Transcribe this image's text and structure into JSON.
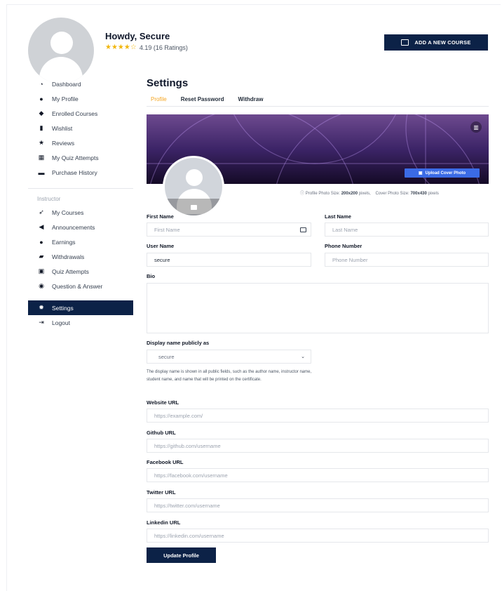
{
  "header": {
    "greeting": "Howdy, Secure",
    "stars": "★★★★☆",
    "rating_text": "4.19 (16 Ratings)",
    "add_course_label": "ADD A NEW COURSE"
  },
  "sidebar": {
    "items": [
      {
        "label": "Dashboard",
        "icon": "dashboard-icon",
        "glyph": "◔"
      },
      {
        "label": "My Profile",
        "icon": "user-icon",
        "glyph": "●"
      },
      {
        "label": "Enrolled Courses",
        "icon": "graduation-cap-icon",
        "glyph": "◆"
      },
      {
        "label": "Wishlist",
        "icon": "bookmark-icon",
        "glyph": "▮"
      },
      {
        "label": "Reviews",
        "icon": "star-icon",
        "glyph": "★"
      },
      {
        "label": "My Quiz Attempts",
        "icon": "quiz-icon",
        "glyph": "▦"
      },
      {
        "label": "Purchase History",
        "icon": "cart-icon",
        "glyph": "▬"
      }
    ],
    "section_label": "Instructor",
    "instructor_items": [
      {
        "label": "My Courses",
        "icon": "rocket-icon",
        "glyph": "➶"
      },
      {
        "label": "Announcements",
        "icon": "megaphone-icon",
        "glyph": "◀"
      },
      {
        "label": "Earnings",
        "icon": "dollar-icon",
        "glyph": "●"
      },
      {
        "label": "Withdrawals",
        "icon": "wallet-icon",
        "glyph": "▰"
      },
      {
        "label": "Quiz Attempts",
        "icon": "question-icon",
        "glyph": "▣"
      },
      {
        "label": "Question & Answer",
        "icon": "chat-icon",
        "glyph": "◉"
      }
    ],
    "settings_label": "Settings",
    "logout_label": "Logout"
  },
  "main": {
    "title": "Settings",
    "tabs": [
      "Profile",
      "Reset Password",
      "Withdraw"
    ],
    "upload_cover_label": "Upload Cover Photo",
    "photo_info": {
      "profile_prefix": "Profile Photo Size: ",
      "profile_size": "200x200",
      "profile_suffix": " pixels,",
      "cover_prefix": "Cover Photo Size: ",
      "cover_size": "700x430",
      "cover_suffix": " pixels"
    },
    "fields": {
      "first_name": {
        "label": "First Name",
        "placeholder": "First Name"
      },
      "last_name": {
        "label": "Last Name",
        "placeholder": "Last Name"
      },
      "user_name": {
        "label": "User Name",
        "value": "secure"
      },
      "phone": {
        "label": "Phone Number",
        "placeholder": "Phone Number"
      },
      "bio": {
        "label": "Bio"
      },
      "display_name": {
        "label": "Display name publicly as",
        "value": "secure"
      },
      "display_help": "The display name is shown in all public fields, such as the author name, instructor name, student name, and name that will be printed on the certificate.",
      "website": {
        "label": "Website URL",
        "placeholder": "https://example.com/"
      },
      "github": {
        "label": "Github URL",
        "placeholder": "https://github.com/username"
      },
      "facebook": {
        "label": "Facebook URL",
        "placeholder": "https://facebook.com/username"
      },
      "twitter": {
        "label": "Twitter URL",
        "placeholder": "https://twitter.com/username"
      },
      "linkedin": {
        "label": "Linkedin URL",
        "placeholder": "https://linkedin.com/username"
      }
    },
    "update_label": "Update Profile"
  },
  "colors": {
    "primary": "#0c2247",
    "accent": "#f5a623",
    "star": "#f1b60c",
    "upload": "#3b6be6"
  }
}
